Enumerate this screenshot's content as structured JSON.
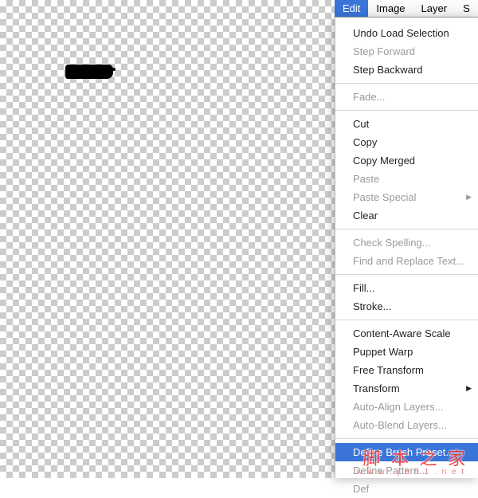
{
  "menubar": {
    "edit": "Edit",
    "image": "Image",
    "layer": "Layer",
    "s": "S"
  },
  "menu": {
    "undo": "Undo Load Selection",
    "stepForward": "Step Forward",
    "stepBackward": "Step Backward",
    "fade": "Fade...",
    "cut": "Cut",
    "copy": "Copy",
    "copyMerged": "Copy Merged",
    "paste": "Paste",
    "pasteSpecial": "Paste Special",
    "clear": "Clear",
    "checkSpelling": "Check Spelling...",
    "findReplace": "Find and Replace Text...",
    "fill": "Fill...",
    "stroke": "Stroke...",
    "contentAware": "Content-Aware Scale",
    "puppetWarp": "Puppet Warp",
    "freeTransform": "Free Transform",
    "transform": "Transform",
    "autoAlign": "Auto-Align Layers...",
    "autoBlend": "Auto-Blend Layers...",
    "defineBrush": "Define Brush Preset...",
    "definePattern": "Define Pattern...",
    "defineCustom": "Def"
  },
  "watermark": {
    "main": "脚 本 之 家",
    "sub": "w w w . j b 5 1 . n e t"
  }
}
